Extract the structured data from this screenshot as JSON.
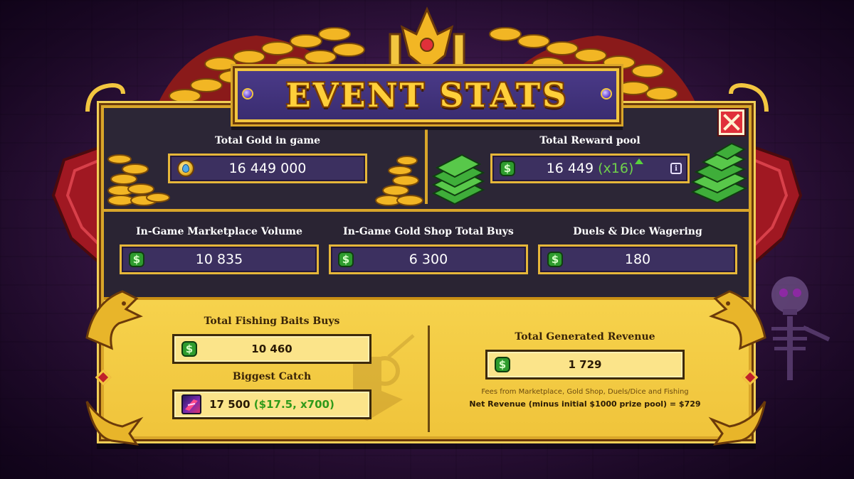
{
  "title": "EVENT STATS",
  "close_icon": "close-icon",
  "colors": {
    "panel_dark": "#2c2636",
    "field_purple": "#3c3060",
    "gold_border": "#e6b73a",
    "gold_panel": "#f6d24c",
    "multiplier_green": "#6fd14a",
    "close_red": "#e0303a"
  },
  "top": {
    "total_gold": {
      "label": "Total Gold in game",
      "value": "16 449 000",
      "icon": "gold-coin-icon"
    },
    "total_reward_pool": {
      "label": "Total Reward pool",
      "value": "16 449",
      "multiplier": "(x16)",
      "icon": "dollar-icon",
      "info_icon": "info-icon"
    }
  },
  "middle": {
    "marketplace_volume": {
      "label": "In-Game Marketplace Volume",
      "value": "10 835",
      "icon": "dollar-icon"
    },
    "gold_shop_buys": {
      "label": "In-Game Gold Shop Total Buys",
      "value": "6 300",
      "icon": "dollar-icon"
    },
    "duels_dice": {
      "label": "Duels & Dice Wagering",
      "value": "180",
      "icon": "dollar-icon"
    }
  },
  "bottom": {
    "fishing_baits": {
      "label": "Total Fishing Baits Buys",
      "value": "10 460",
      "icon": "dollar-icon"
    },
    "biggest_catch": {
      "label": "Biggest Catch",
      "value": "17 500",
      "extra": "($17.5, x700)",
      "icon": "fish-icon"
    },
    "generated_revenue": {
      "label": "Total Generated Revenue",
      "value": "1 729",
      "icon": "dollar-icon",
      "note": "Fees from Marketplace, Gold Shop, Duels/Dice and Fishing",
      "net_note": "Net Revenue (minus initial $1000 prize pool) = $729"
    }
  }
}
